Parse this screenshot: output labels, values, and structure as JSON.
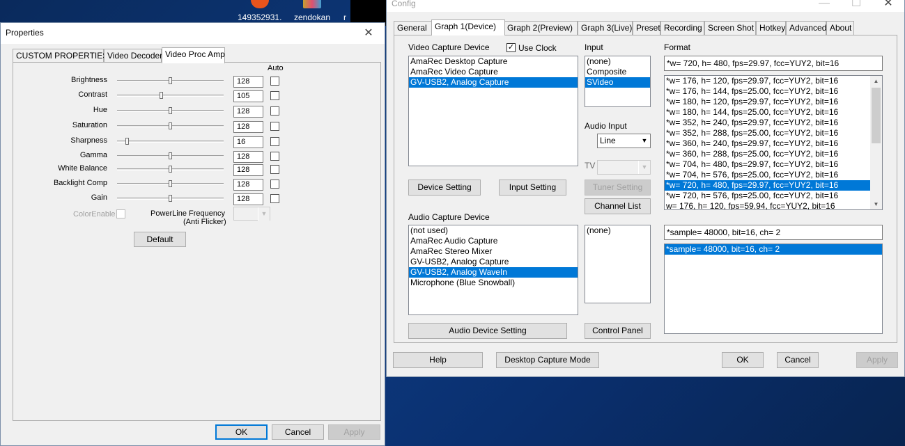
{
  "desktop": {
    "icons": [
      {
        "label": "149352931..."
      },
      {
        "label": "zendokan"
      },
      {
        "label": "r"
      }
    ]
  },
  "properties": {
    "title": "Properties",
    "tabs": [
      "CUSTOM PROPERTIES",
      "Video Decoder",
      "Video Proc Amp"
    ],
    "auto_header": "Auto",
    "sliders": [
      {
        "label": "Brightness",
        "value": "128",
        "level": 0.5
      },
      {
        "label": "Contrast",
        "value": "105",
        "level": 0.41
      },
      {
        "label": "Hue",
        "value": "128",
        "level": 0.5
      },
      {
        "label": "Saturation",
        "value": "128",
        "level": 0.5
      },
      {
        "label": "Sharpness",
        "value": "16",
        "level": 0.08
      },
      {
        "label": "Gamma",
        "value": "128",
        "level": 0.5
      },
      {
        "label": "White Balance",
        "value": "128",
        "level": 0.5
      },
      {
        "label": "Backlight Comp",
        "value": "128",
        "level": 0.5
      },
      {
        "label": "Gain",
        "value": "128",
        "level": 0.5
      }
    ],
    "color_enable": "ColorEnable",
    "powerline_line1": "PowerLine Frequency",
    "powerline_line2": "(Anti Flicker)",
    "default_btn": "Default",
    "ok": "OK",
    "cancel": "Cancel",
    "apply": "Apply"
  },
  "config": {
    "title": "Config",
    "tabs": [
      "General",
      "Graph 1(Device)",
      "Graph 2(Preview)",
      "Graph 3(Live)",
      "Preset",
      "Recording",
      "Screen Shot",
      "Hotkey",
      "Advanced",
      "About"
    ],
    "video_capture_device_label": "Video Capture Device",
    "use_clock": "Use Clock",
    "video_devices": [
      "AmaRec Desktop Capture",
      "AmaRec Video Capture",
      "GV-USB2, Analog Capture"
    ],
    "video_selected": 2,
    "input_label": "Input",
    "inputs": [
      "(none)",
      "Composite",
      "SVideo"
    ],
    "input_selected": 2,
    "audio_input_label": "Audio Input",
    "audio_input_value": "Line",
    "tv_label": "TV",
    "format_label": "Format",
    "format_value": "*w= 720, h= 480, fps=29.97,  fcc=YUY2, bit=16",
    "formats": [
      "*w= 176, h= 120, fps=29.97,  fcc=YUY2, bit=16",
      "*w= 176, h= 144, fps=25.00,  fcc=YUY2, bit=16",
      "*w= 180, h= 120, fps=29.97,  fcc=YUY2, bit=16",
      "*w= 180, h= 144, fps=25.00,  fcc=YUY2, bit=16",
      "*w= 352, h= 240, fps=29.97,  fcc=YUY2, bit=16",
      "*w= 352, h= 288, fps=25.00,  fcc=YUY2, bit=16",
      "*w= 360, h= 240, fps=29.97,  fcc=YUY2, bit=16",
      "*w= 360, h= 288, fps=25.00,  fcc=YUY2, bit=16",
      "*w= 704, h= 480, fps=29.97,  fcc=YUY2, bit=16",
      "*w= 704, h= 576, fps=25.00,  fcc=YUY2, bit=16",
      "*w= 720, h= 480, fps=29.97,  fcc=YUY2, bit=16",
      "*w= 720, h= 576, fps=25.00,  fcc=YUY2, bit=16",
      "w= 176, h= 120, fps=59.94,  fcc=YUY2, bit=16"
    ],
    "format_selected": 10,
    "device_setting": "Device Setting",
    "input_setting": "Input Setting",
    "tuner_setting": "Tuner Setting",
    "channel_list": "Channel List",
    "audio_capture_device_label": "Audio Capture Device",
    "audio_devices": [
      "(not used)",
      "AmaRec Audio Capture",
      "AmaRec Stereo Mixer",
      "GV-USB2, Analog Capture",
      "GV-USB2, Analog WaveIn",
      "Microphone (Blue Snowball)"
    ],
    "audio_selected": 4,
    "audio_inputs": [
      "(none)"
    ],
    "audio_format_value": "*sample= 48000, bit=16, ch= 2",
    "audio_formats": [
      "*sample= 48000, bit=16, ch= 2"
    ],
    "audio_format_selected": 0,
    "audio_device_setting": "Audio Device Setting",
    "control_panel": "Control Panel",
    "help": "Help",
    "desktop_capture_mode": "Desktop Capture Mode",
    "ok": "OK",
    "cancel": "Cancel",
    "apply": "Apply"
  }
}
